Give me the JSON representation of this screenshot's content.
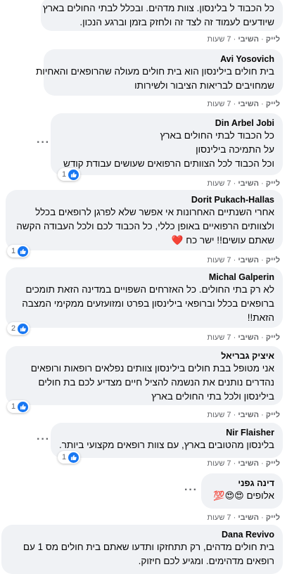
{
  "comments": [
    {
      "author": "",
      "lines": [
        "כל הכבוד ל בלינסון. צוות מדהים. ובכלל לבתי החולים בארץ",
        "שיודעים לעמוד זה לצד זה ולחזק בזמן וברגע הנכון."
      ],
      "like": "לייק",
      "reply": "השיבי",
      "time": "7 שעות",
      "reactions": ""
    },
    {
      "author": "Avi Yosovich",
      "lines": [
        "בית חולים בילינסון הוא בית חולים מעולה שהרופאים והאחיות",
        "שמחויבים לבריאות הציבור ולשירותו"
      ],
      "like": "לייק",
      "reply": "השיבי",
      "time": "7 שעות",
      "reactions": ""
    },
    {
      "author": "Din Arbel Jobi",
      "lines": [
        "כל הכבוד לבתי החולים בארץ",
        "על התמיכה בילינסון",
        "וכל הכבוד לכל הצוותים הרפואים שעושים עבודת קודש"
      ],
      "like": "לייק",
      "reply": "השיבי",
      "time": "7 שעות",
      "reactions": "1"
    },
    {
      "author": "Dorit Pukach-Hallas",
      "lines": [
        "אחרי השנתיים האחרונות אי אפשר שלא לפרגן לרופאים בכלל",
        "ולצוותים הרפואיים באופן כללי, כל הכבוד לכם ולכל העבודה הקשה",
        "שאתם עושים!! ישר כח"
      ],
      "like": "לייק",
      "reply": "השיבי",
      "time": "7 שעות",
      "reactions": "1"
    },
    {
      "author": "Michal Galperin",
      "lines": [
        "לא רק בתי החולים. כל האזרחים השפויים במדינה הזאת תומכים",
        "ברופאים בכלל וברופאי בילינסון בפרט ומזועזעים ממקימי המצבה",
        "הזאת!!"
      ],
      "like": "לייק",
      "reply": "השיבי",
      "time": "7 שעות",
      "reactions": "2"
    },
    {
      "author": "איציק גבריאל",
      "lines": [
        "אני מטופל בבת חולים בילינסון צוותים נפלאים רופאות ורופאים",
        "נהדרים נותנים את הנשמה להציל חיים מצדיע לכם בת חולים",
        "בילינסון ולכל בתי החולים בארץ"
      ],
      "like": "לייק",
      "reply": "השיבי",
      "time": "7 שעות",
      "reactions": "1"
    },
    {
      "author": "Nir Flaisher",
      "lines": [
        "בלינסון מהטובים בארץ, עם צוות רופאים מקצועי ביותר."
      ],
      "like": "לייק",
      "reply": "השיבי",
      "time": "7 שעות",
      "reactions": "1"
    },
    {
      "author": "דינה גפני",
      "lines": [
        "אלופים"
      ],
      "like": "לייק",
      "reply": "השיבי",
      "time": "7 שעות",
      "reactions": ""
    },
    {
      "author": "Dana Revivo",
      "lines": [
        "בית חולים מדהים, רק תתחזקו ותדעו שאתם בית חולים מס 1 עם",
        "רופאים מדהימים. ומגיע לכם חיזוק."
      ],
      "like": "",
      "reply": "",
      "time": "",
      "reactions": ""
    }
  ],
  "emoji": {
    "heart": "❤️",
    "hundred": "💯",
    "heart_eyes": "😍"
  }
}
